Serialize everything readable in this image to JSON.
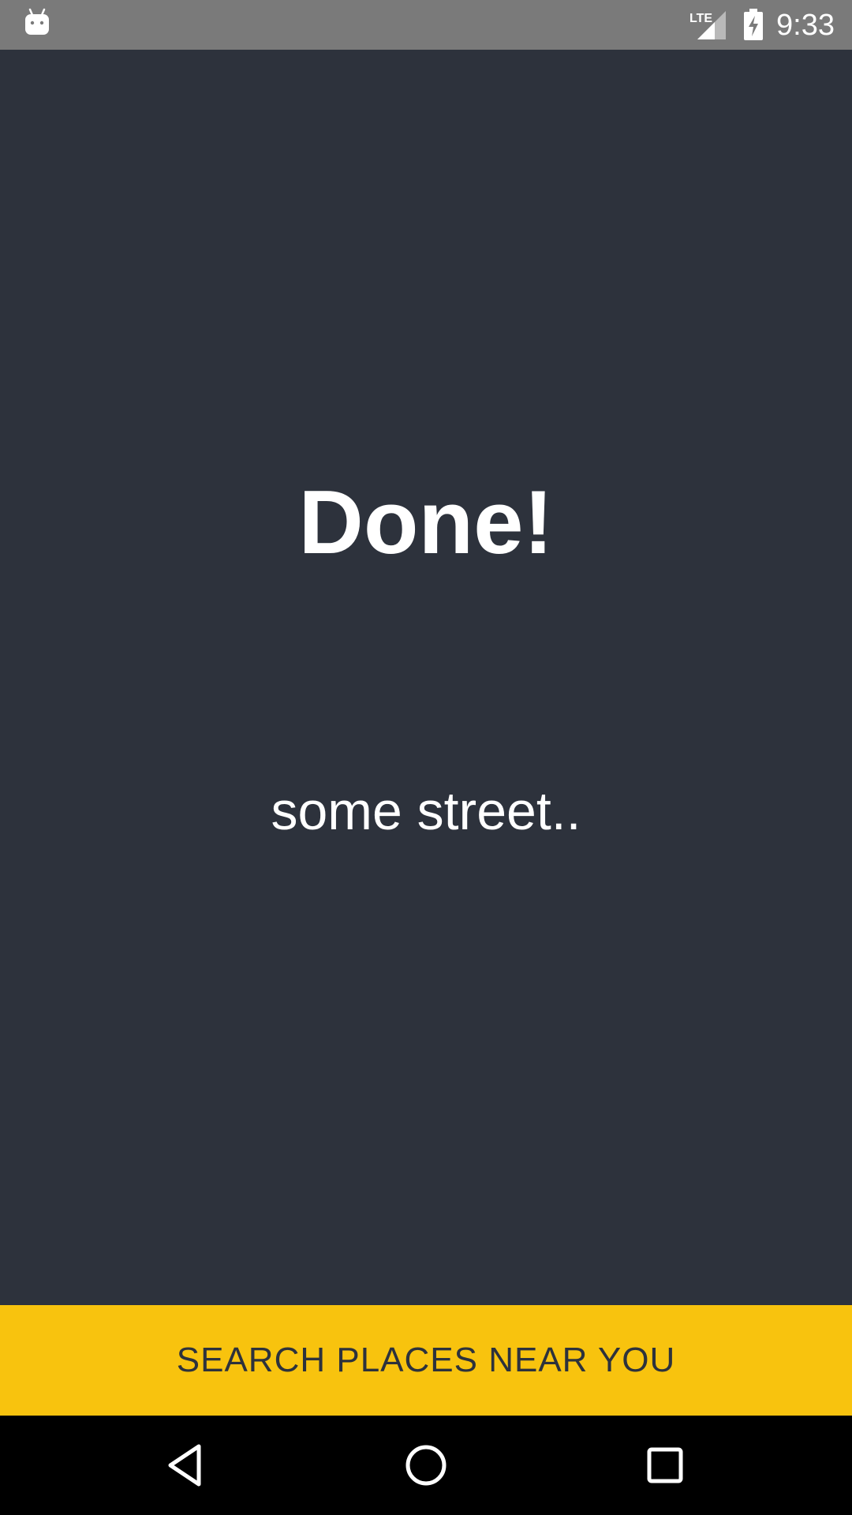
{
  "status_bar": {
    "time": "9:33",
    "network": "LTE",
    "left_icon": "android-debug-icon",
    "signal_icon": "cell-signal-icon",
    "battery_icon": "battery-charging-icon"
  },
  "main": {
    "title": "Done!",
    "subtitle": "some street.."
  },
  "action_button": {
    "label": "SEARCH PLACES NEAR YOU"
  },
  "nav_bar": {
    "back_icon": "back-icon",
    "home_icon": "home-icon",
    "recent_icon": "recent-apps-icon"
  },
  "colors": {
    "background": "#2d323c",
    "status_bar": "#7a7a7a",
    "accent": "#f8c30e",
    "nav_bar": "#000000",
    "text": "#ffffff"
  }
}
